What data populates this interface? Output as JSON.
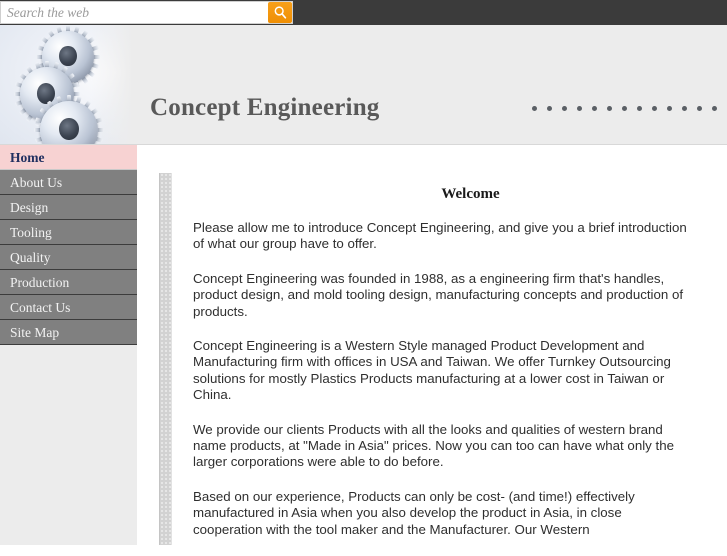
{
  "topbar": {
    "search": {
      "placeholder": "Search the web",
      "value": "",
      "button_icon": "search-icon"
    },
    "background_color": "#3b3b3b"
  },
  "header": {
    "site_title": "Concept Engineering",
    "logo_alt": "three-gears-photo",
    "dot_count": 14,
    "dot_color": "#5b6066",
    "background_color": "#ececec"
  },
  "sidebar": {
    "items": [
      {
        "label": "Home",
        "active": true
      },
      {
        "label": "About Us",
        "active": false
      },
      {
        "label": "Design",
        "active": false
      },
      {
        "label": "Tooling",
        "active": false
      },
      {
        "label": "Quality",
        "active": false
      },
      {
        "label": "Production",
        "active": false
      },
      {
        "label": "Contact Us",
        "active": false
      },
      {
        "label": "Site Map",
        "active": false
      }
    ],
    "active_background": "#f7d2d2",
    "item_background": "#808080"
  },
  "main": {
    "heading": "Welcome",
    "paragraphs": [
      "Please allow me to introduce Concept Engineering, and give you a brief introduction of what our group have to offer.",
      "Concept Engineering was founded in 1988, as a engineering firm that's handles, product design, and mold tooling design, manufacturing concepts and production of products.",
      "Concept Engineering is a Western Style managed Product Development and Manufacturing firm with offices in USA and Taiwan. We offer Turnkey Outsourcing solutions for mostly Plastics Products manufacturing at a lower cost in Taiwan or China.",
      "We provide our clients Products with all the looks and qualities of western brand name products, at \"Made in Asia\" prices. Now you can too can have what only the larger corporations were able to do before.",
      "Based on our experience, Products can only be cost- (and time!) effectively manufactured in Asia when you also develop the product in Asia, in close cooperation with the tool maker and the Manufacturer. Our Western"
    ]
  }
}
